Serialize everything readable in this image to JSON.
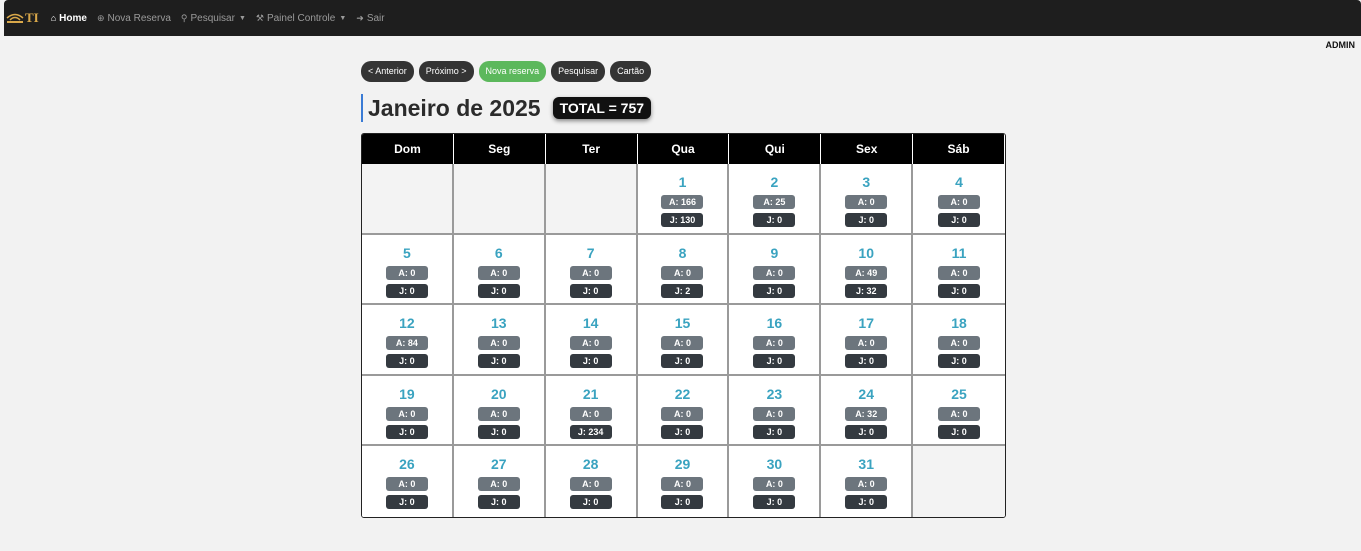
{
  "navbar": {
    "brand": "TI",
    "items": [
      {
        "label": "Home",
        "icon": "home-icon",
        "active": true
      },
      {
        "label": "Nova Reserva",
        "icon": "circle-plus-icon"
      },
      {
        "label": "Pesquisar",
        "icon": "search-icon",
        "dropdown": true
      },
      {
        "label": "Painel Controle",
        "icon": "tools-icon",
        "dropdown": true
      },
      {
        "label": "Sair",
        "icon": "logout-icon"
      }
    ]
  },
  "user": "ADMIN",
  "toolbar": {
    "prev": "< Anterior",
    "next": "Próximo >",
    "new_booking": "Nova reserva",
    "search": "Pesquisar",
    "card": "Cartão"
  },
  "title": "Janeiro de 2025",
  "total": "TOTAL = 757",
  "colors": {
    "accent_day": "#3aa3c0",
    "green_button": "#5cb85c",
    "a_badge": "#6c757d",
    "j_badge": "#343a40"
  },
  "weekdays": [
    "Dom",
    "Seg",
    "Ter",
    "Qua",
    "Qui",
    "Sex",
    "Sáb"
  ],
  "leading_empty": 3,
  "days": [
    {
      "day": "1",
      "a": "A: 166",
      "j": "J: 130"
    },
    {
      "day": "2",
      "a": "A: 25",
      "j": "J: 0"
    },
    {
      "day": "3",
      "a": "A: 0",
      "j": "J: 0"
    },
    {
      "day": "4",
      "a": "A: 0",
      "j": "J: 0"
    },
    {
      "day": "5",
      "a": "A: 0",
      "j": "J: 0"
    },
    {
      "day": "6",
      "a": "A: 0",
      "j": "J: 0"
    },
    {
      "day": "7",
      "a": "A: 0",
      "j": "J: 0"
    },
    {
      "day": "8",
      "a": "A: 0",
      "j": "J: 2"
    },
    {
      "day": "9",
      "a": "A: 0",
      "j": "J: 0"
    },
    {
      "day": "10",
      "a": "A: 49",
      "j": "J: 32"
    },
    {
      "day": "11",
      "a": "A: 0",
      "j": "J: 0"
    },
    {
      "day": "12",
      "a": "A: 84",
      "j": "J: 0"
    },
    {
      "day": "13",
      "a": "A: 0",
      "j": "J: 0"
    },
    {
      "day": "14",
      "a": "A: 0",
      "j": "J: 0"
    },
    {
      "day": "15",
      "a": "A: 0",
      "j": "J: 0"
    },
    {
      "day": "16",
      "a": "A: 0",
      "j": "J: 0"
    },
    {
      "day": "17",
      "a": "A: 0",
      "j": "J: 0"
    },
    {
      "day": "18",
      "a": "A: 0",
      "j": "J: 0"
    },
    {
      "day": "19",
      "a": "A: 0",
      "j": "J: 0"
    },
    {
      "day": "20",
      "a": "A: 0",
      "j": "J: 0"
    },
    {
      "day": "21",
      "a": "A: 0",
      "j": "J: 234"
    },
    {
      "day": "22",
      "a": "A: 0",
      "j": "J: 0"
    },
    {
      "day": "23",
      "a": "A: 0",
      "j": "J: 0"
    },
    {
      "day": "24",
      "a": "A: 32",
      "j": "J: 0"
    },
    {
      "day": "25",
      "a": "A: 0",
      "j": "J: 0"
    },
    {
      "day": "26",
      "a": "A: 0",
      "j": "J: 0"
    },
    {
      "day": "27",
      "a": "A: 0",
      "j": "J: 0"
    },
    {
      "day": "28",
      "a": "A: 0",
      "j": "J: 0"
    },
    {
      "day": "29",
      "a": "A: 0",
      "j": "J: 0"
    },
    {
      "day": "30",
      "a": "A: 0",
      "j": "J: 0"
    },
    {
      "day": "31",
      "a": "A: 0",
      "j": "J: 0"
    }
  ]
}
